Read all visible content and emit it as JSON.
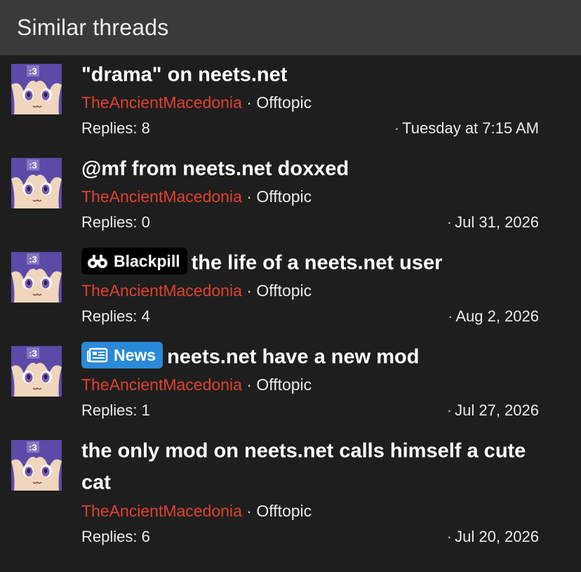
{
  "header": {
    "title": "Similar threads"
  },
  "labels": {
    "separator": "·",
    "replies_prefix": "Replies:",
    "avatar_text": ":3"
  },
  "threads": [
    {
      "title": "\"drama\" on neets.net",
      "prefix": null,
      "author": "TheAncientMacedonia",
      "forum": "Offtopic",
      "replies": "8",
      "date": "Tuesday at 7:15 AM"
    },
    {
      "title": "@mf from neets.net doxxed",
      "prefix": null,
      "author": "TheAncientMacedonia",
      "forum": "Offtopic",
      "replies": "0",
      "date": "Jul 31, 2026"
    },
    {
      "title": "the life of a neets.net user",
      "prefix": {
        "label": "Blackpill",
        "icon": "binoculars-icon",
        "color": "#000000"
      },
      "author": "TheAncientMacedonia",
      "forum": "Offtopic",
      "replies": "4",
      "date": "Aug 2, 2026"
    },
    {
      "title": "neets.net have a new mod",
      "prefix": {
        "label": "News",
        "icon": "newspaper-icon",
        "color": "#2a8ad8"
      },
      "author": "TheAncientMacedonia",
      "forum": "Offtopic",
      "replies": "1",
      "date": "Jul 27, 2026"
    },
    {
      "title": "the only mod on neets.net calls himself a cute cat",
      "prefix": null,
      "author": "TheAncientMacedonia",
      "forum": "Offtopic",
      "replies": "6",
      "date": "Jul 20, 2026"
    }
  ],
  "colors": {
    "background": "#1e1e1e",
    "header_background": "#3a3a3a",
    "author": "#e0422d",
    "title": "#ffffff"
  }
}
